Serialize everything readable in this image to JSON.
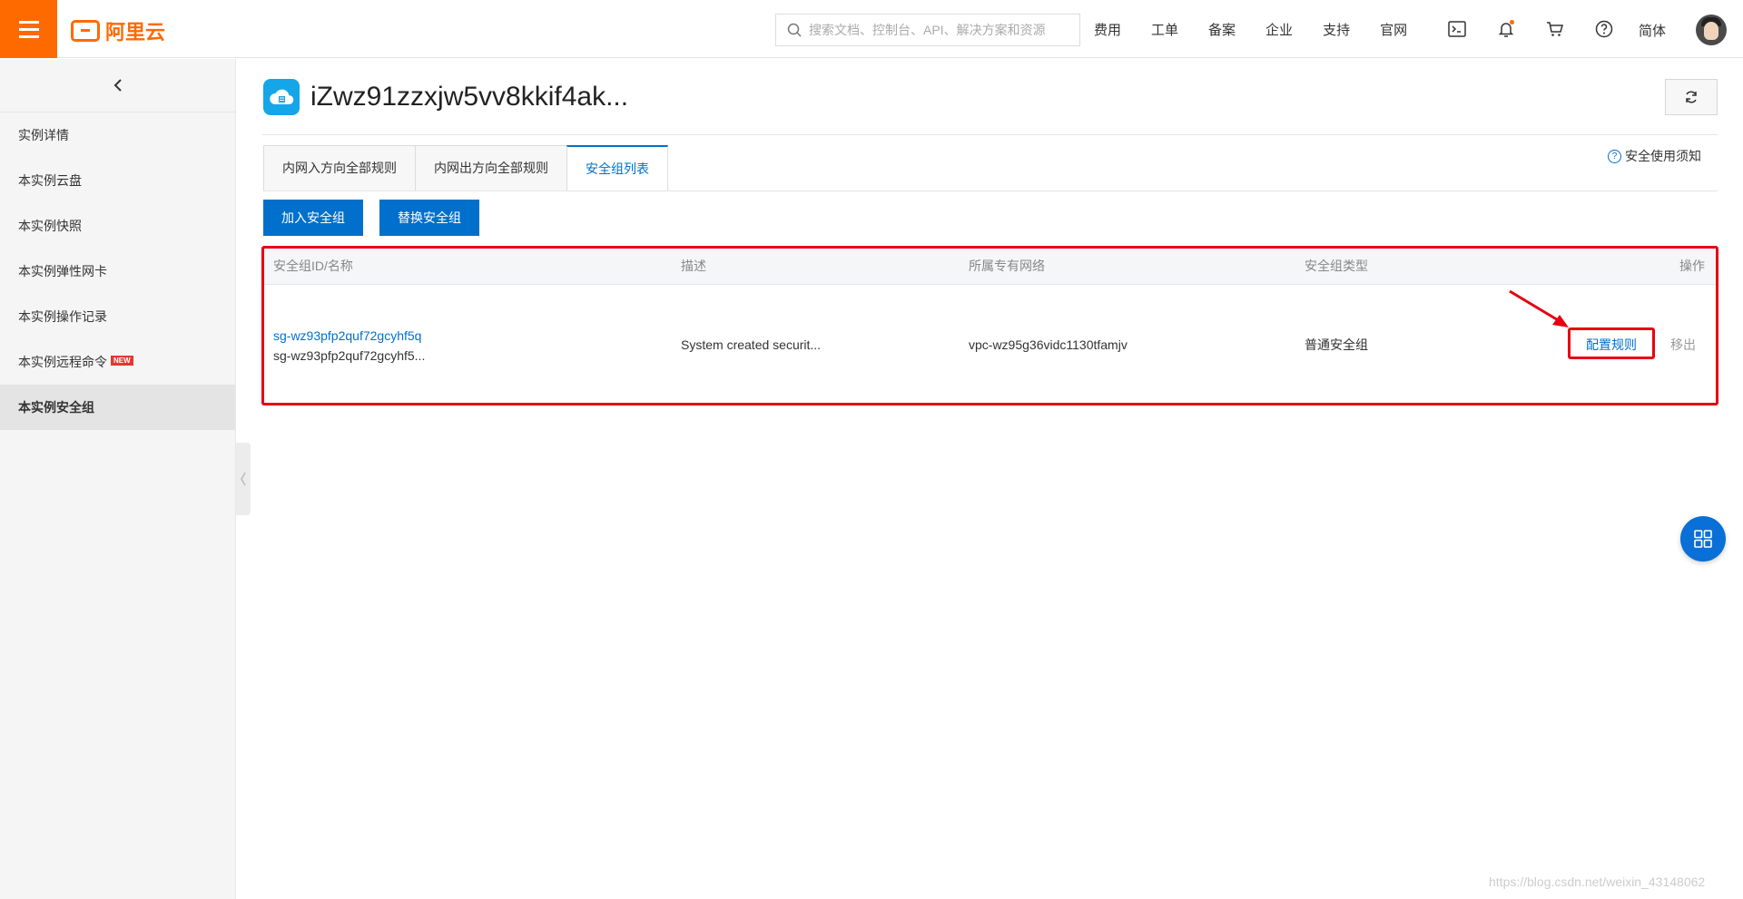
{
  "brand": {
    "logo_text": "阿里云",
    "accent": "#ff6a00"
  },
  "search": {
    "placeholder": "搜索文档、控制台、API、解决方案和资源"
  },
  "topnav": {
    "items": [
      "费用",
      "工单",
      "备案",
      "企业",
      "支持",
      "官网"
    ],
    "language": "简体"
  },
  "sidebar": {
    "items": [
      {
        "label": "实例详情"
      },
      {
        "label": "本实例云盘"
      },
      {
        "label": "本实例快照"
      },
      {
        "label": "本实例弹性网卡"
      },
      {
        "label": "本实例操作记录"
      },
      {
        "label": "本实例远程命令",
        "badge": "NEW"
      },
      {
        "label": "本实例安全组",
        "active": true
      }
    ]
  },
  "main": {
    "title": "iZwz91zzxjw5vv8kkif4ak...",
    "notice": "安全使用须知",
    "tabs": [
      {
        "label": "内网入方向全部规则"
      },
      {
        "label": "内网出方向全部规则"
      },
      {
        "label": "安全组列表",
        "active": true
      }
    ],
    "buttons": {
      "join": "加入安全组",
      "replace": "替换安全组"
    },
    "table": {
      "headers": [
        "安全组ID/名称",
        "描述",
        "所属专有网络",
        "安全组类型",
        "操作"
      ],
      "rows": [
        {
          "id": "sg-wz93pfp2quf72gcyhf5q",
          "name": "sg-wz93pfp2quf72gcyhf5...",
          "description": "System created securit...",
          "vpc": "vpc-wz95g36vidc1130tfamjv",
          "type": "普通安全组",
          "action_config": "配置规则",
          "action_remove": "移出"
        }
      ]
    }
  },
  "watermark": "https://blog.csdn.net/weixin_43148062"
}
